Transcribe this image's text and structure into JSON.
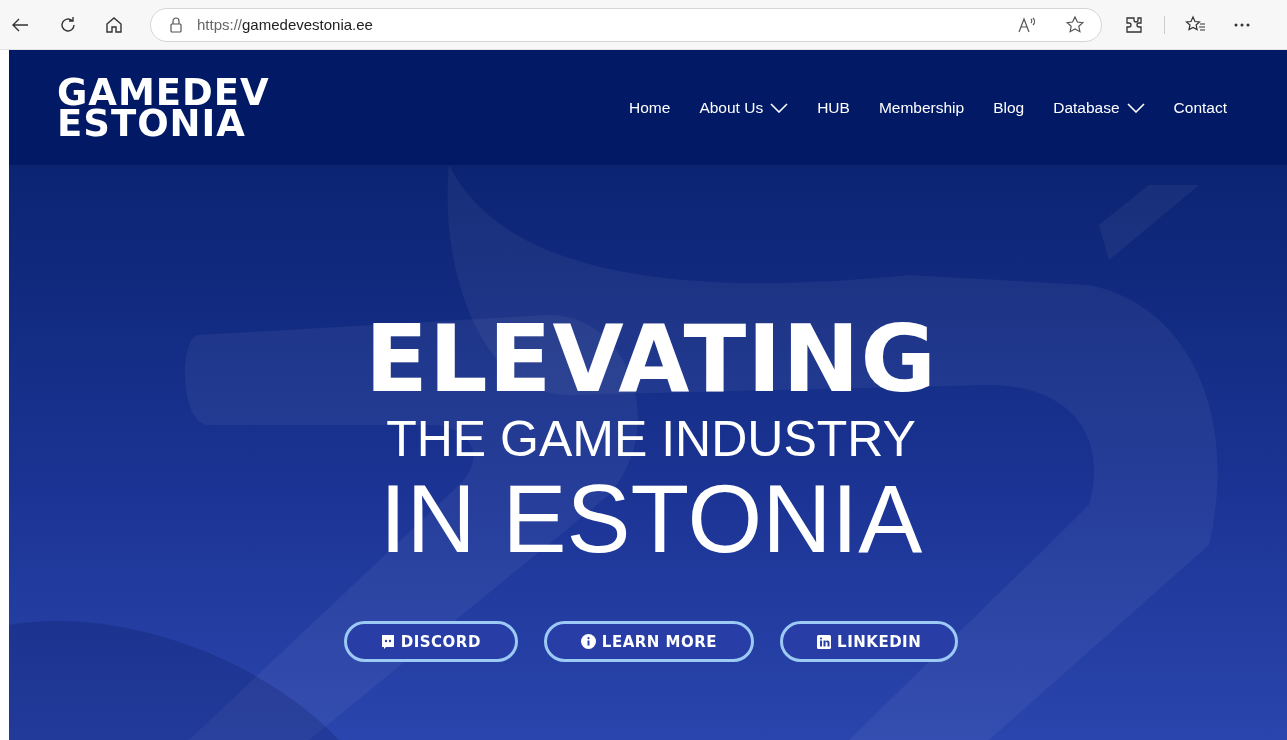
{
  "browser": {
    "url_scheme": "https://",
    "url_host": "gamedevestonia.ee"
  },
  "site": {
    "logo_lines": [
      "GAMEDEV",
      "ESTONIA"
    ],
    "nav": [
      {
        "label": "Home",
        "dropdown": false
      },
      {
        "label": "About Us",
        "dropdown": true
      },
      {
        "label": "HUB",
        "dropdown": false
      },
      {
        "label": "Membership",
        "dropdown": false
      },
      {
        "label": "Blog",
        "dropdown": false
      },
      {
        "label": "Database",
        "dropdown": true
      },
      {
        "label": "Contact",
        "dropdown": false
      }
    ]
  },
  "hero": {
    "headline": "ELEVATING",
    "subline": "THE GAME INDUSTRY",
    "tagline": "IN ESTONIA",
    "buttons": [
      {
        "label": "DISCORD",
        "kind": "discord"
      },
      {
        "label": "LEARN MORE",
        "kind": "info"
      },
      {
        "label": "LINKEDIN",
        "kind": "linkedin"
      }
    ]
  }
}
